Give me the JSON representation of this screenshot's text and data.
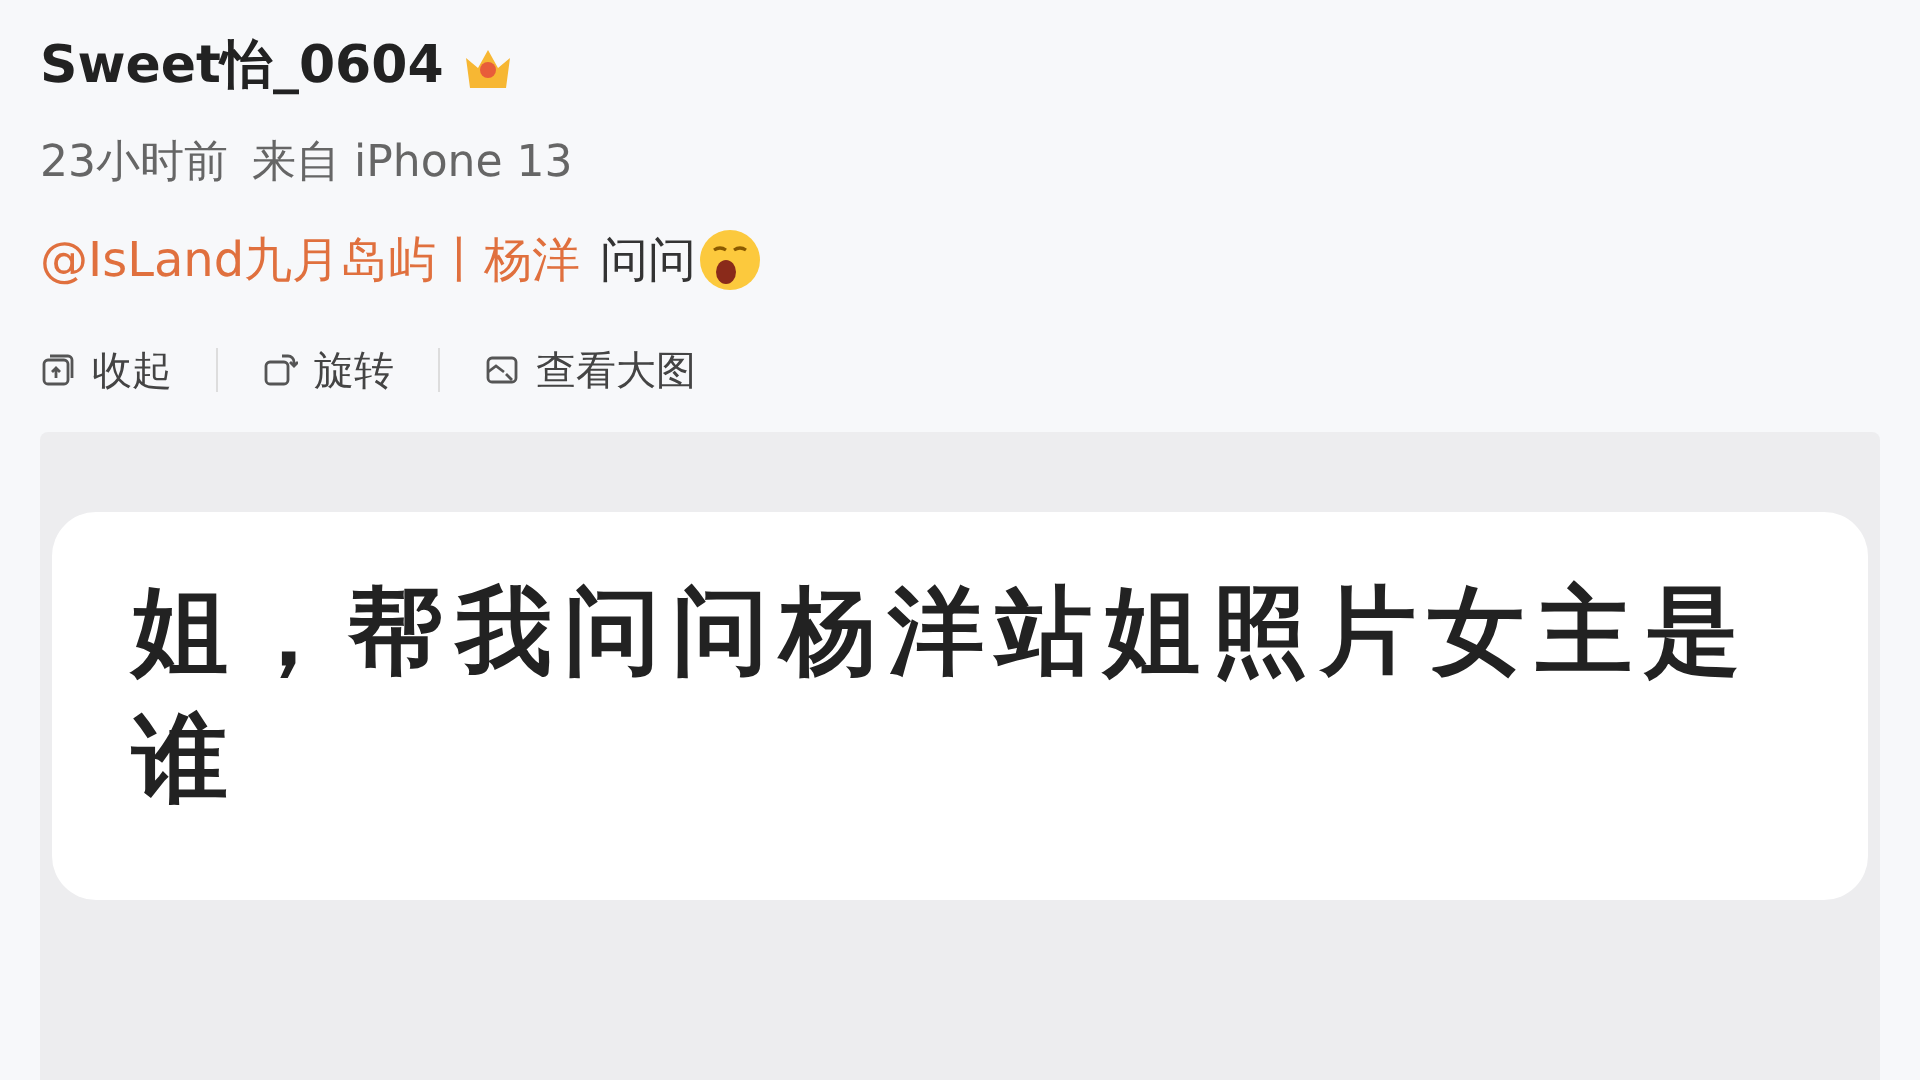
{
  "post": {
    "author": "Sweet怡_0604",
    "time": "23小时前",
    "source": "来自 iPhone 13",
    "mention": "@IsLand九月岛屿丨杨洋",
    "text": "问问"
  },
  "actions": [
    {
      "kind": "collapse",
      "label": "收起"
    },
    {
      "kind": "rotate",
      "label": "旋转"
    },
    {
      "kind": "enlarge",
      "label": "查看大图"
    }
  ],
  "image": {
    "message": "姐，帮我问问杨洋站姐照片女主是谁"
  }
}
